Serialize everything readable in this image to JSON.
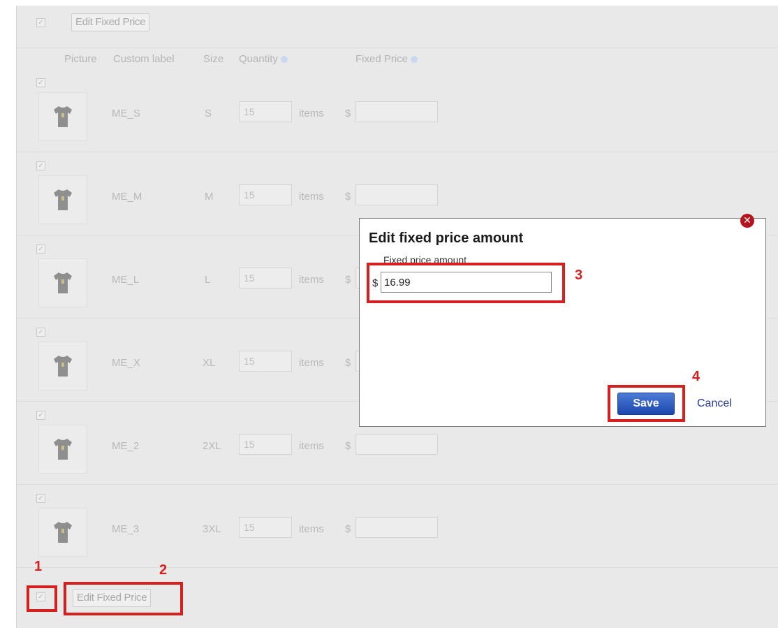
{
  "top_toolbar": {
    "edit_label": "Edit Fixed Price"
  },
  "table": {
    "headers": {
      "picture": "Picture",
      "custom_label": "Custom label",
      "size": "Size",
      "quantity": "Quantity",
      "fixed_price": "Fixed Price"
    },
    "items_unit": "items",
    "currency": "$",
    "rows": [
      {
        "label": "ME_S",
        "size": "S",
        "qty": "15"
      },
      {
        "label": "ME_M",
        "size": "M",
        "qty": "15"
      },
      {
        "label": "ME_L",
        "size": "L",
        "qty": "15"
      },
      {
        "label": "ME_X",
        "size": "XL",
        "qty": "15"
      },
      {
        "label": "ME_2",
        "size": "2XL",
        "qty": "15"
      },
      {
        "label": "ME_3",
        "size": "3XL",
        "qty": "15"
      }
    ]
  },
  "bottom_toolbar": {
    "edit_label": "Edit Fixed Price"
  },
  "modal": {
    "title": "Edit fixed price amount",
    "field_label": "Fixed price amount",
    "currency": "$",
    "amount_value": "16.99",
    "save_label": "Save",
    "cancel_label": "Cancel",
    "close_glyph": "✕"
  },
  "annotations": {
    "step1": "1",
    "step2": "2",
    "step3": "3",
    "step4": "4"
  },
  "colors": {
    "annotation_red": "#d61f1f",
    "save_blue": "#1c46ad",
    "close_red": "#b3151c"
  },
  "icons": {
    "row_picture": "tshirt-icon",
    "help": "help-icon",
    "close": "close-icon"
  }
}
